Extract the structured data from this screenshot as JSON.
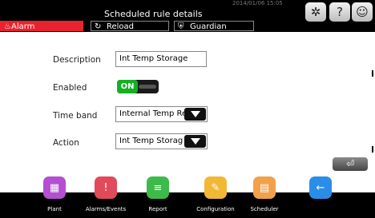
{
  "header": {
    "title": "Scheduled rule details",
    "datetime": "2014/01/06 15:05"
  },
  "header_icons": [
    "bug-icon",
    "help-icon",
    "user-settings-icon"
  ],
  "tabs": [
    {
      "label": "Alarm",
      "icon": "bell-icon"
    },
    {
      "label": "Reload",
      "icon": "reload-icon"
    },
    {
      "label": "Guardian",
      "icon": "shield-icon"
    }
  ],
  "form": {
    "description_label": "Description",
    "description_value": "Int Temp Storage",
    "enabled_label": "Enabled",
    "enabled_state": "ON",
    "timeband_label": "Time band",
    "timeband_value": "Internal Temp Re",
    "action_label": "Action",
    "action_value": "Int Temp Storag"
  },
  "enter_symbol": "⏎",
  "nav": [
    {
      "label": "Plant",
      "color": "#b44fd1",
      "icon": "plant-icon"
    },
    {
      "label": "Alarms/Events",
      "color": "#e04a5a",
      "icon": "alarms-events-icon"
    },
    {
      "label": "Report",
      "color": "#3dbb4a",
      "icon": "report-icon"
    },
    {
      "label": "Configuration",
      "color": "#f2b735",
      "icon": "configuration-icon"
    },
    {
      "label": "Scheduler",
      "color": "#f2a04a",
      "icon": "scheduler-icon"
    },
    {
      "label": "",
      "color": "#2a8de8",
      "icon": "back-arrow-icon"
    }
  ]
}
